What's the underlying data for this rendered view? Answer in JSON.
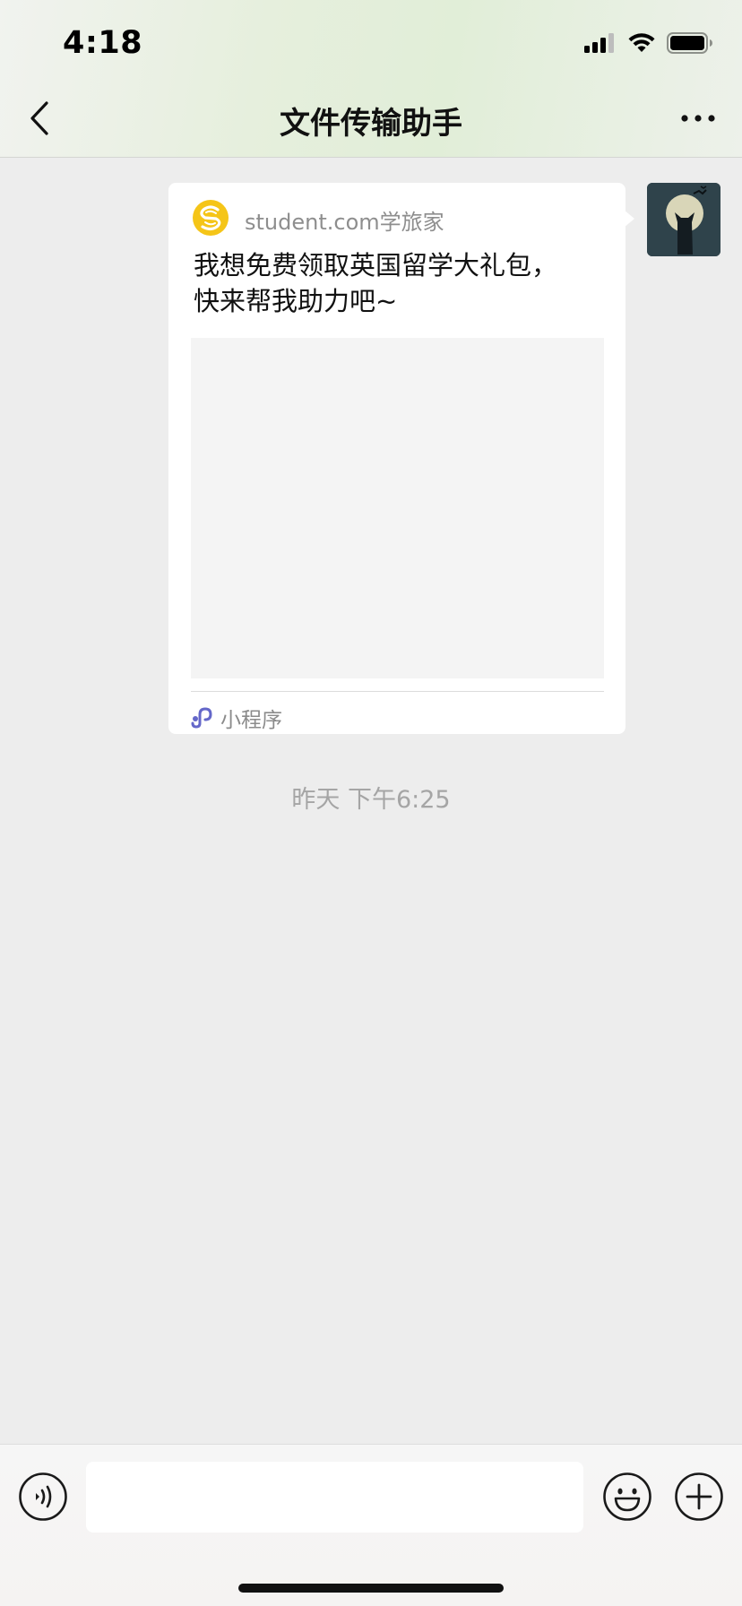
{
  "status_bar": {
    "time": "4:18",
    "icons": [
      "cellular-signal-icon",
      "wifi-icon",
      "battery-icon"
    ]
  },
  "nav": {
    "back_icon": "chevron-left-icon",
    "title": "文件传输助手",
    "more_icon": "more-dots-icon"
  },
  "message": {
    "sender_avatar": "avatar-cat-moon",
    "card": {
      "source_icon": "student-logo-icon",
      "source_name": "student.com学旅家",
      "text": "我想免费领取英国留学大礼包，\n快来帮我助力吧~",
      "footer_icon": "mini-program-icon",
      "footer_label": "小程序"
    }
  },
  "timestamp": "昨天 下午6:25",
  "input_bar": {
    "voice_icon": "voice-icon",
    "input_value": "",
    "emoji_icon": "emoji-icon",
    "plus_icon": "plus-icon"
  },
  "colors": {
    "background": "#ededed",
    "card": "#ffffff",
    "logo_yellow": "#f5c518",
    "mini_program_blue": "#6467c9"
  }
}
